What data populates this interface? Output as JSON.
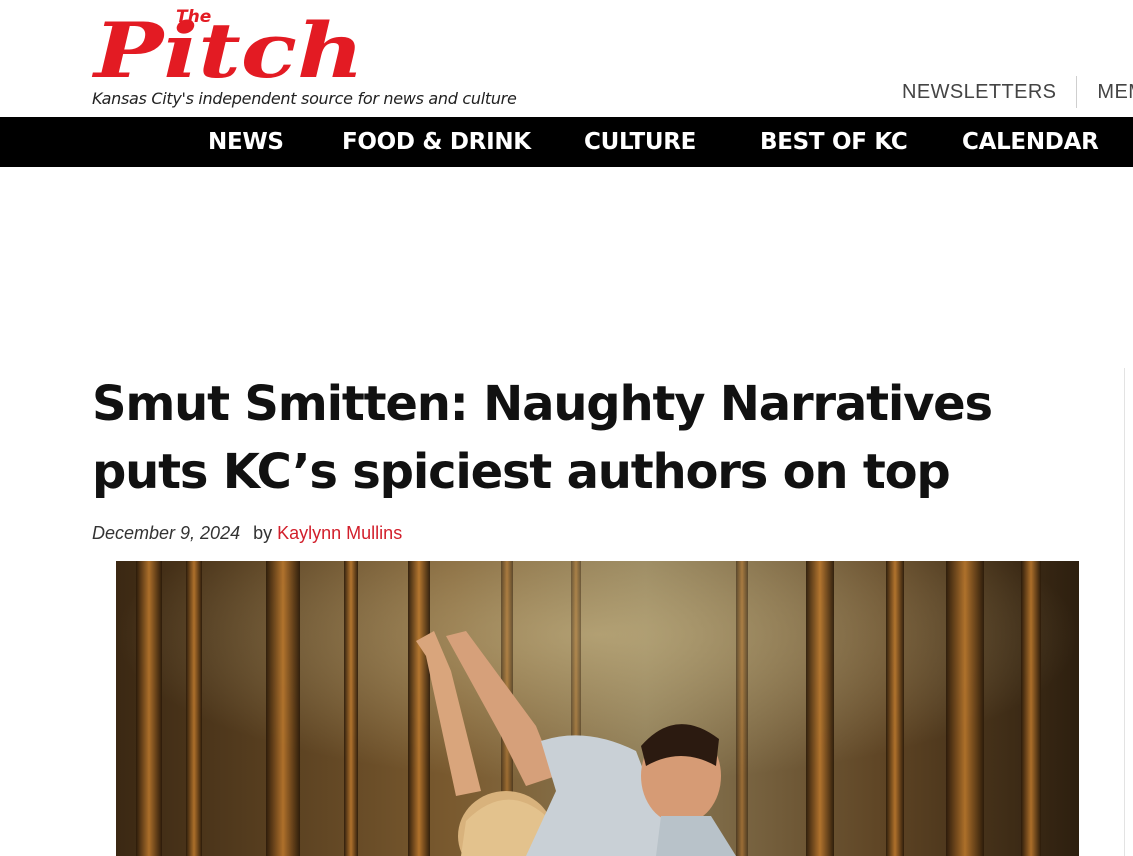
{
  "site": {
    "logo_small": "The",
    "logo_main": "Pitch",
    "tagline": "Kansas City's independent source for news and culture",
    "brand_color": "#e31b23"
  },
  "utility_nav": [
    {
      "label": "NEWSLETTERS"
    },
    {
      "label": "MEMB"
    }
  ],
  "main_nav": [
    {
      "label": "NEWS"
    },
    {
      "label": "FOOD & DRINK"
    },
    {
      "label": "CULTURE"
    },
    {
      "label": "BEST OF KC"
    },
    {
      "label": "CALENDAR"
    }
  ],
  "article": {
    "headline": "Smut Smitten: Naughty Narratives puts KC’s spiciest authors on top",
    "date": "December 9, 2024",
    "by_label": "by",
    "author": "Kaylynn Mullins",
    "author_color": "#d21f2b",
    "image_icon": "hero-photo-couple-dancing-forest"
  }
}
